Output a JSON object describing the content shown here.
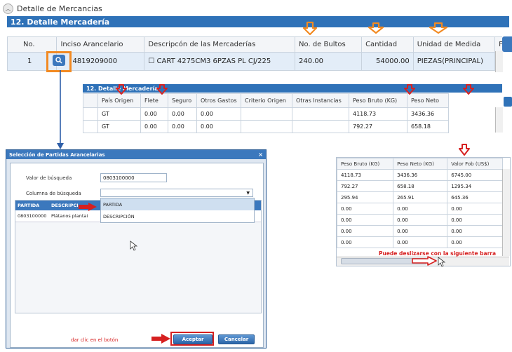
{
  "header": {
    "title": "Detalle de Mercancias",
    "section": "12. Detalle Mercadería"
  },
  "main_table": {
    "headers": [
      "No.",
      "Inciso Arancelario",
      "Descripcón de las Mercaderías",
      "No. de Bultos",
      "Cantidad",
      "Unidad de Medida",
      "F"
    ],
    "row": [
      "1",
      "4819209000",
      "☐ CART 4275CM3 6PZAS PL CJ/225",
      "240.00",
      "54000.00",
      "PIEZAS(PRINCIPAL)",
      "G"
    ]
  },
  "detail_table": {
    "title": "12. Detalle Mercadería",
    "headers": [
      "País Origen",
      "Flete",
      "Seguro",
      "Otros Gastos",
      "Criterio Origen",
      "Otras Instancias",
      "Peso Bruto (KG)",
      "Peso Neto"
    ],
    "rows": [
      [
        "GT",
        "0.00",
        "0.00",
        "0.00",
        "",
        "",
        "4118.73",
        "3436.36"
      ],
      [
        "GT",
        "0.00",
        "0.00",
        "0.00",
        "",
        "",
        "792.27",
        "658.18"
      ]
    ]
  },
  "right_table": {
    "headers": [
      "Peso Bruto (KG)",
      "Peso Neto (KG)",
      "Valor Fob (US$)"
    ],
    "rows": [
      [
        "4118.73",
        "3436.36",
        "6745.00"
      ],
      [
        "792.27",
        "658.18",
        "1295.34"
      ],
      [
        "295.94",
        "265.91",
        "645.36"
      ],
      [
        "0.00",
        "0.00",
        "0.00"
      ],
      [
        "0.00",
        "0.00",
        "0.00"
      ],
      [
        "0.00",
        "0.00",
        "0.00"
      ],
      [
        "0.00",
        "0.00",
        "0.00"
      ]
    ],
    "note": "Puede deslizarse con la siguiente barra"
  },
  "dialog": {
    "title": "Selección de Partidas Arancelarias",
    "search_value_label": "Valor de búsqueda",
    "search_value": "0803100000",
    "search_column_label": "Columna de búsqueda",
    "options": [
      "PARTIDA",
      "DESCRIPCIÓN"
    ],
    "list_headers": [
      "PARTIDA",
      "DESCRIPCI"
    ],
    "list_row": [
      "0803100000",
      "Plátanos plantai"
    ],
    "instruction": "dar clic en el botón",
    "accept_label": "Aceptar",
    "cancel_label": "Cancelar"
  },
  "colors": {
    "accent_blue": "#2f72b8",
    "annotation_orange": "#f28a22",
    "annotation_red": "#d62020"
  }
}
